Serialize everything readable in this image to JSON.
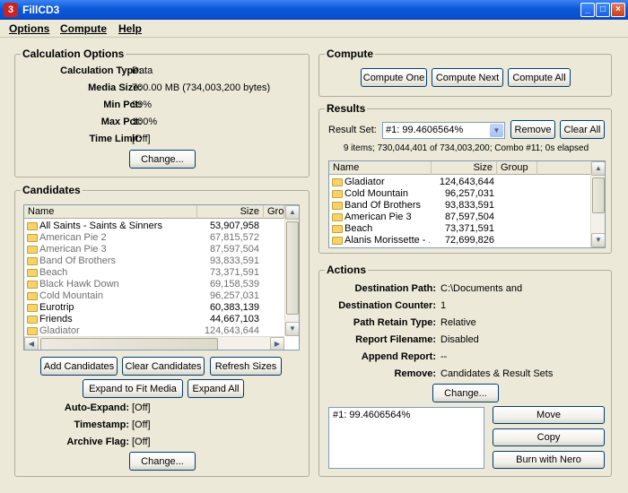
{
  "window": {
    "title": "FillCD3",
    "icon": "app-logo-icon"
  },
  "menu": [
    "Options",
    "Compute",
    "Help"
  ],
  "calc": {
    "legend": "Calculation Options",
    "rows": [
      {
        "label": "Calculation Type:",
        "value": "Data"
      },
      {
        "label": "Media Size:",
        "value": "700.00 MB (734,003,200 bytes)"
      },
      {
        "label": "Min Pct:",
        "value": "99%"
      },
      {
        "label": "Max Pct:",
        "value": "100%"
      },
      {
        "label": "Time Limit:",
        "value": "[Off]"
      }
    ],
    "change_label": "Change..."
  },
  "candidates": {
    "legend": "Candidates",
    "columns": [
      "Name",
      "Size",
      "Gro"
    ],
    "rows": [
      {
        "name": "All Saints - Saints & Sinners",
        "size": "53,907,958",
        "dim": false
      },
      {
        "name": "American Pie 2",
        "size": "67,815,572",
        "dim": true
      },
      {
        "name": "American Pie 3",
        "size": "87,597,504",
        "dim": true
      },
      {
        "name": "Band Of Brothers",
        "size": "93,833,591",
        "dim": true
      },
      {
        "name": "Beach",
        "size": "73,371,591",
        "dim": true
      },
      {
        "name": "Black Hawk Down",
        "size": "69,158,539",
        "dim": true
      },
      {
        "name": "Cold Mountain",
        "size": "96,257,031",
        "dim": true
      },
      {
        "name": "Eurotrip",
        "size": "60,383,139",
        "dim": false
      },
      {
        "name": "Friends",
        "size": "44,667,103",
        "dim": false
      },
      {
        "name": "Gladiator",
        "size": "124,643,644",
        "dim": true
      }
    ],
    "buttons": {
      "add": "Add Candidates",
      "clear": "Clear Candidates",
      "refresh": "Refresh Sizes",
      "expand_fit": "Expand to Fit Media",
      "expand_all": "Expand All"
    },
    "options": [
      {
        "label": "Auto-Expand:",
        "value": "[Off]"
      },
      {
        "label": "Timestamp:",
        "value": "[Off]"
      },
      {
        "label": "Archive Flag:",
        "value": "[Off]"
      }
    ],
    "change_label": "Change..."
  },
  "compute": {
    "legend": "Compute",
    "buttons": [
      "Compute One",
      "Compute Next",
      "Compute All"
    ]
  },
  "results": {
    "legend": "Results",
    "set_label": "Result Set:",
    "set_value": "#1:  99.4606564%",
    "remove_label": "Remove",
    "clear_all_label": "Clear All",
    "summary": "9 items; 730,044,401 of 734,003,200; Combo #11; 0s elapsed",
    "columns": [
      "Name",
      "Size",
      "Group"
    ],
    "rows": [
      {
        "name": "Gladiator",
        "size": "124,643,644"
      },
      {
        "name": "Cold Mountain",
        "size": "96,257,031"
      },
      {
        "name": "Band Of Brothers",
        "size": "93,833,591"
      },
      {
        "name": "American Pie 3",
        "size": "87,597,504"
      },
      {
        "name": "Beach",
        "size": "73,371,591"
      },
      {
        "name": "Alanis Morissette - ...",
        "size": "72,699,826"
      }
    ]
  },
  "actions": {
    "legend": "Actions",
    "rows": [
      {
        "label": "Destination Path:",
        "value": "C:\\Documents and"
      },
      {
        "label": "Destination Counter:",
        "value": "1"
      },
      {
        "label": "Path Retain Type:",
        "value": "Relative"
      },
      {
        "label": "Report Filename:",
        "value": "Disabled"
      },
      {
        "label": "Append Report:",
        "value": "--"
      },
      {
        "label": "Remove:",
        "value": "Candidates & Result Sets"
      }
    ],
    "change_label": "Change...",
    "log_text": "#1:  99.4606564%",
    "move_label": "Move",
    "copy_label": "Copy",
    "burn_label": "Burn with Nero"
  }
}
